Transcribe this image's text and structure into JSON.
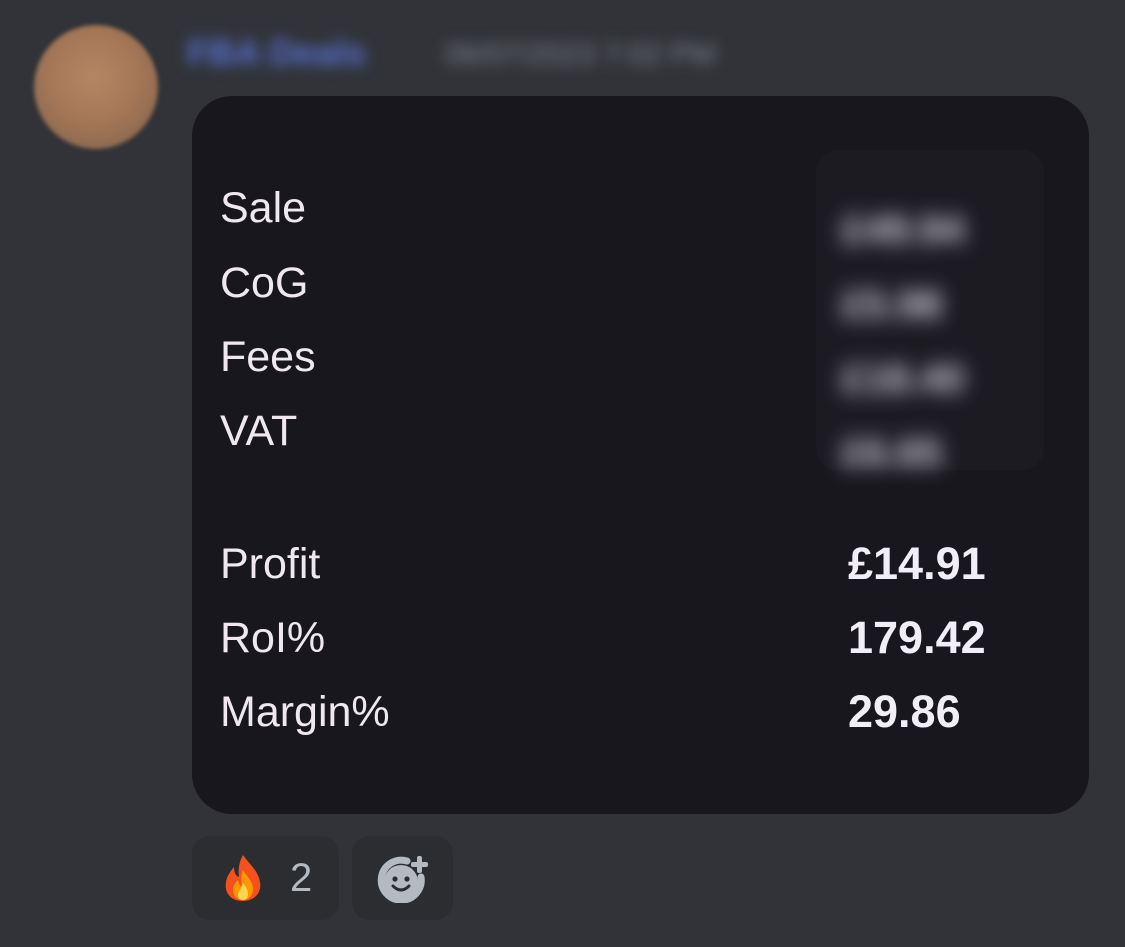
{
  "message": {
    "author": {
      "name": "FBA Deals",
      "timestamp": "06/07/2023 7:02 PM"
    },
    "card": {
      "rows": [
        {
          "label": "Sale",
          "value": "£49.94"
        },
        {
          "label": "CoG",
          "value": "£5.98"
        },
        {
          "label": "Fees",
          "value": "£18.40"
        },
        {
          "label": "VAT",
          "value": "£6.65"
        }
      ],
      "metrics": [
        {
          "label": "Profit",
          "value": "£14.91"
        },
        {
          "label": "RoI%",
          "value": "179.42"
        },
        {
          "label": "Margin%",
          "value": "29.86"
        }
      ]
    },
    "reactions": [
      {
        "icon": "fire-emoji-icon",
        "count": "2"
      },
      {
        "icon": "add-reaction-icon"
      }
    ]
  },
  "colors": {
    "background": "#313338",
    "card_background": "#18171d",
    "reaction_pill": "#2b2d31",
    "author_blue": "#5a73d8"
  }
}
